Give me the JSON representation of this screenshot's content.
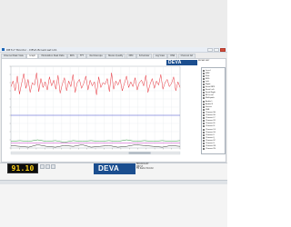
{
  "window": {
    "title": "DB7x7 Monitor - DEVA Broadcast Ltd."
  },
  "tabs": [
    {
      "label": "Channel Peak View"
    },
    {
      "label": "Graph"
    },
    {
      "label": "Modulation Peak Data"
    },
    {
      "label": "RDS"
    },
    {
      "label": "FFT"
    },
    {
      "label": "Oscilloscope"
    },
    {
      "label": "Stereo Quality"
    },
    {
      "label": "MPX"
    },
    {
      "label": "Scheduler"
    },
    {
      "label": "Log View"
    },
    {
      "label": "DNS"
    },
    {
      "label": "Channel list"
    }
  ],
  "active_tab_index": 1,
  "brand": {
    "logo_text": "DEVA",
    "small_text": "BROADCAST"
  },
  "legend": [
    {
      "label": "Level",
      "color": "#e8313a"
    },
    {
      "label": "MPX",
      "color": "#2a36c8"
    },
    {
      "label": "Pilot",
      "color": "#1a8a2a"
    },
    {
      "label": "RDS",
      "color": "#c020c0"
    },
    {
      "label": "Left",
      "color": "#2a36c8"
    },
    {
      "label": "Right",
      "color": "#e05ad8"
    },
    {
      "label": "Peak MPX",
      "color": "#1a1a1a"
    },
    {
      "label": "Peak Left",
      "color": "#18a4c4"
    },
    {
      "label": "Peak Right",
      "color": "#888888"
    },
    {
      "label": "RF Level",
      "color": "#c07018"
    },
    {
      "label": "Multipath",
      "color": "#30c030"
    },
    {
      "label": "Audio L",
      "color": "#6040a0"
    },
    {
      "label": "Audio R",
      "color": "#a0a020"
    },
    {
      "label": "Stereo",
      "color": "#d03030"
    },
    {
      "label": "SNR",
      "color": "#309090"
    },
    {
      "label": "Channel A",
      "color": "#3050d0"
    },
    {
      "label": "Channel B",
      "color": "#d03080"
    },
    {
      "label": "Channel C",
      "color": "#50a050"
    },
    {
      "label": "Channel D",
      "color": "#a06030"
    },
    {
      "label": "Channel E",
      "color": "#6060c0"
    },
    {
      "label": "Channel F",
      "color": "#c0c040"
    },
    {
      "label": "Channel G",
      "color": "#40c0c0"
    },
    {
      "label": "Channel H",
      "color": "#c04040"
    },
    {
      "label": "Channel I",
      "color": "#4040c0"
    },
    {
      "label": "Channel J",
      "color": "#8040c0"
    },
    {
      "label": "Channel K",
      "color": "#40a080"
    },
    {
      "label": "Channel L",
      "color": "#a08040"
    },
    {
      "label": "Channel M",
      "color": "#6080a0"
    },
    {
      "label": "Channel N",
      "color": "#c06080"
    }
  ],
  "chart_data": {
    "type": "line",
    "series": [
      {
        "color": "#e8313a",
        "style": "noisy-high",
        "values": [
          75,
          82,
          70,
          88,
          66,
          79,
          91,
          73,
          84,
          68,
          80,
          77,
          92,
          69,
          85,
          74,
          81,
          71,
          87,
          76,
          83,
          72,
          89,
          67,
          78,
          86,
          70,
          82,
          75,
          90,
          68,
          80,
          84,
          73,
          79,
          88,
          71,
          83,
          76,
          81,
          65,
          87,
          74,
          80,
          78,
          85,
          69,
          92,
          72,
          82,
          77,
          84,
          70,
          79,
          88,
          74,
          81,
          75,
          86,
          71,
          80,
          83,
          76,
          89,
          68,
          78,
          85,
          73,
          82,
          77,
          90,
          72,
          80,
          84,
          75,
          79,
          87,
          70,
          81,
          74
        ]
      },
      {
        "color": "#2a36c8",
        "style": "flat-mid",
        "values": [
          40,
          40,
          40,
          40,
          40,
          40,
          40,
          40,
          40,
          40,
          40,
          40,
          40,
          40,
          40,
          40,
          40,
          40,
          40,
          40
        ]
      },
      {
        "color": "#1a8a2a",
        "style": "low-band",
        "values": [
          8,
          9,
          8,
          10,
          8,
          9,
          7,
          9,
          8,
          9,
          8,
          9,
          8,
          10,
          8,
          9,
          8,
          9,
          8,
          9
        ]
      },
      {
        "color": "#c020c0",
        "style": "low-band",
        "values": [
          6,
          6,
          6,
          6,
          6,
          6,
          6,
          6,
          6,
          6,
          6,
          6,
          6,
          6,
          6,
          6,
          6,
          6,
          6,
          6
        ]
      },
      {
        "color": "#1a1a1a",
        "style": "spikes",
        "values": [
          3,
          2,
          1,
          4,
          2,
          1,
          3,
          2,
          4,
          1,
          2,
          3,
          1,
          2,
          4,
          3,
          2,
          1,
          3,
          2
        ]
      }
    ],
    "ylim": [
      0,
      100
    ],
    "grid": true
  },
  "scrollbar": {
    "position": 0.8
  },
  "bottom": {
    "led_value": "91.10",
    "logo_text": "DEVA",
    "right_lines": [
      "BROADCAST",
      "DB7x7",
      "FM Radio Monitor"
    ],
    "info_line": "",
    "status_line": ""
  }
}
